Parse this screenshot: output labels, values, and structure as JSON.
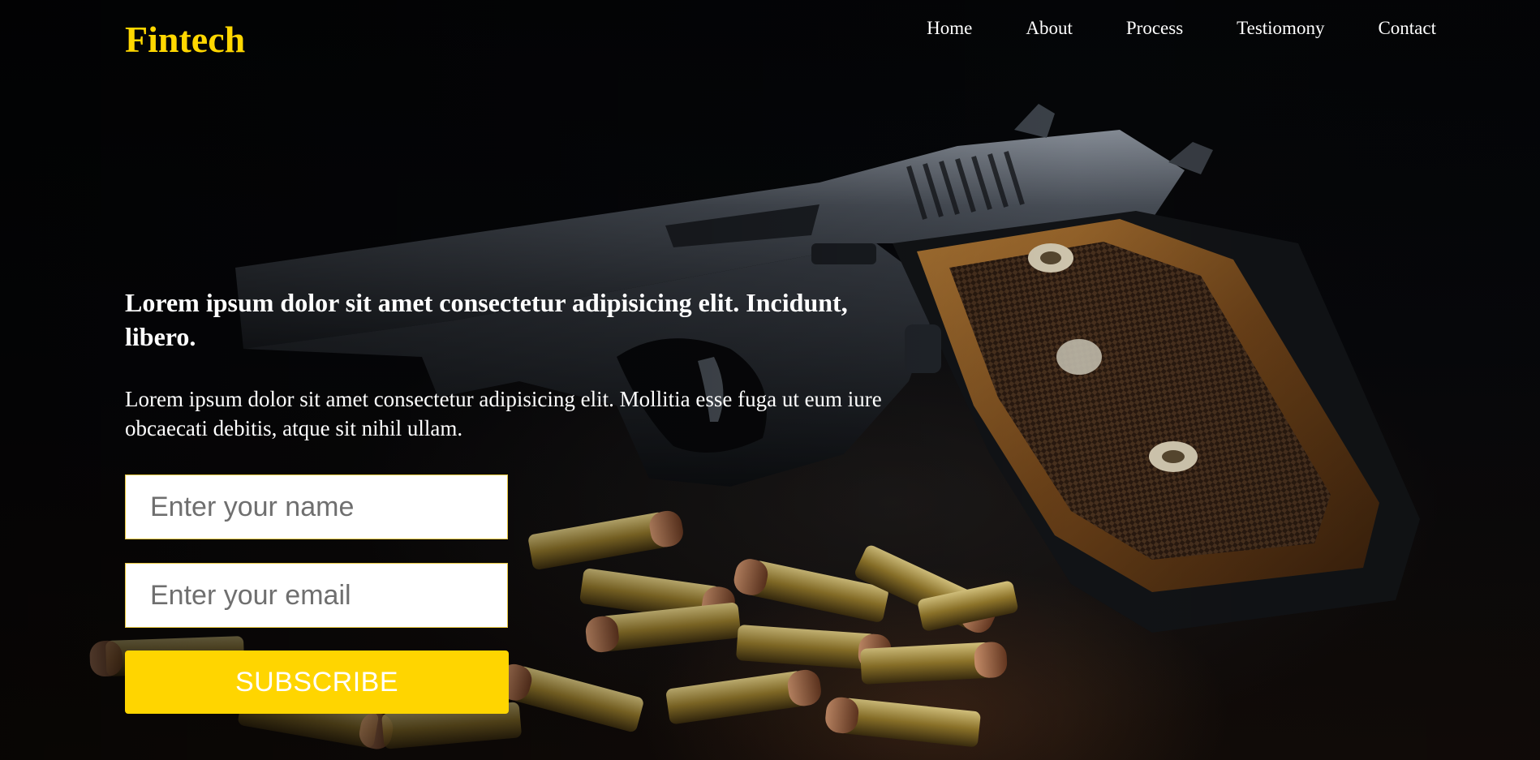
{
  "brand": {
    "name": "Fintech",
    "color": "#ffd700"
  },
  "nav": {
    "items": [
      {
        "label": "Home"
      },
      {
        "label": "About"
      },
      {
        "label": "Process"
      },
      {
        "label": "Testiomony"
      },
      {
        "label": "Contact"
      }
    ]
  },
  "hero": {
    "headline": "Lorem ipsum dolor sit amet consectetur adipisicing elit. Incidunt, libero.",
    "description": "Lorem ipsum dolor sit amet consectetur adipisicing elit. Mollitia esse fuga ut eum iure obcaecati debitis, atque sit nihil ullam.",
    "background_image": "pistol-with-bullets-photo"
  },
  "form": {
    "name_placeholder": "Enter your name",
    "email_placeholder": "Enter your email",
    "submit_label": "SUBSCRIBE",
    "accent_color": "#ffd500"
  }
}
